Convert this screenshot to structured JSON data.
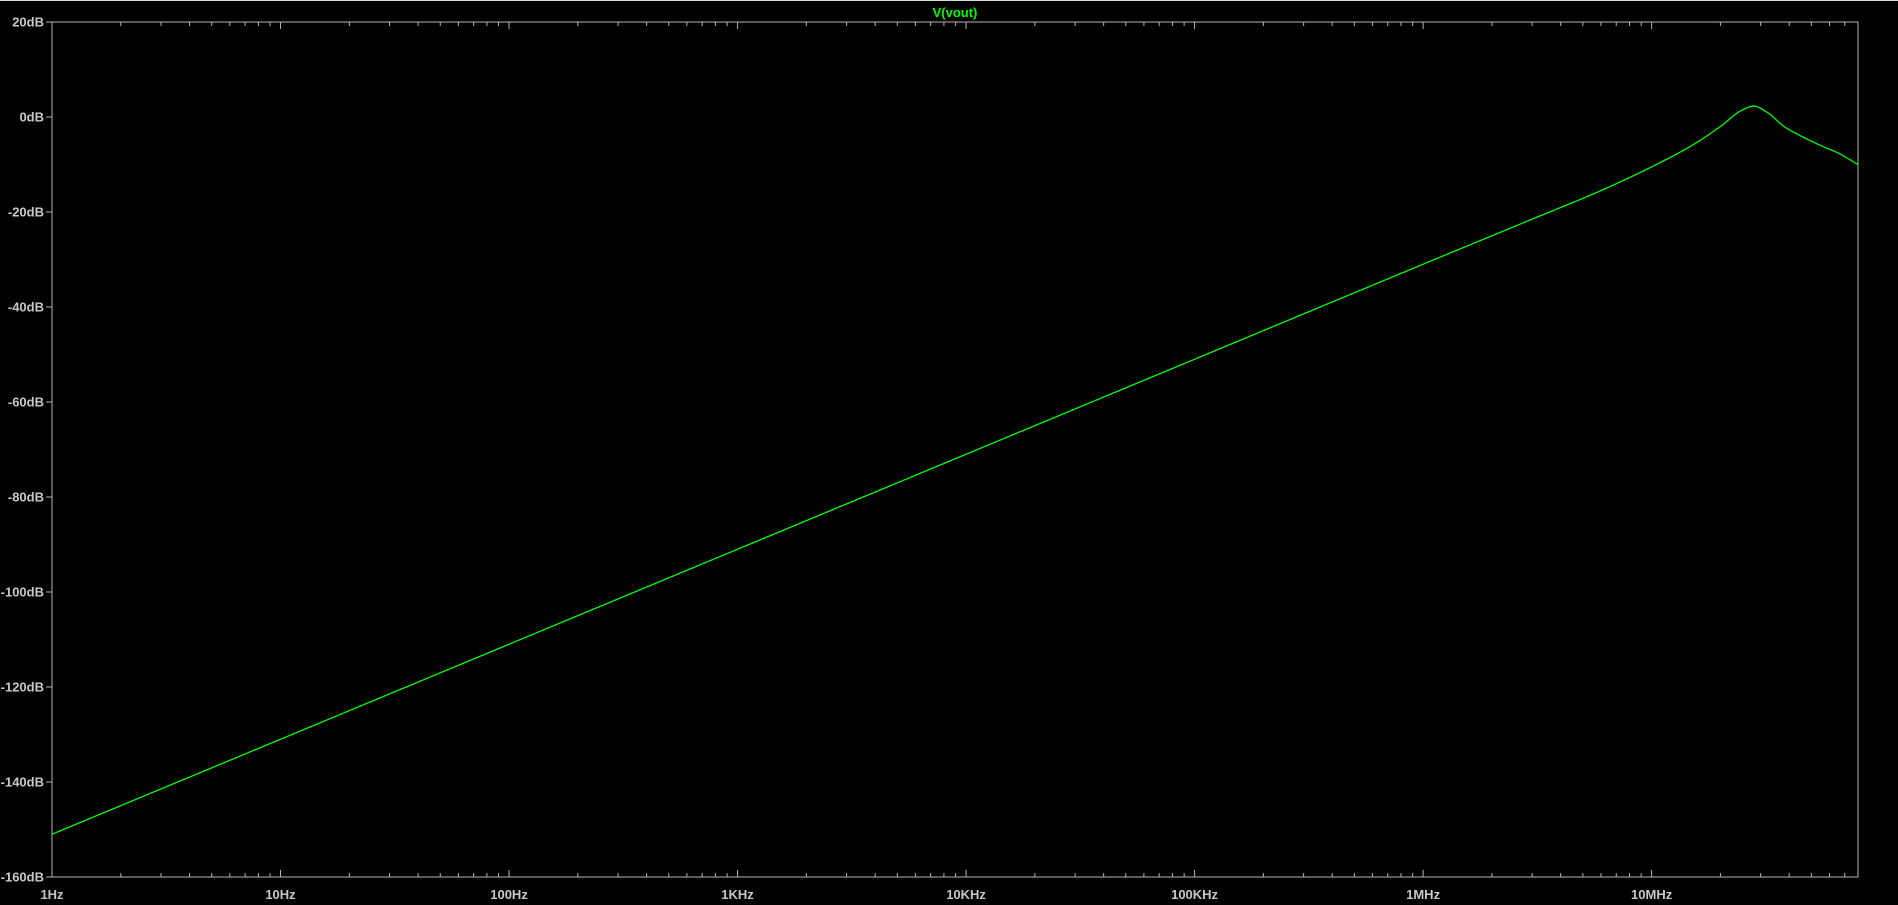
{
  "colors": {
    "background": "#000000",
    "axis": "#b4b4b4",
    "tick_text": "#c8c8c8",
    "trace": "#00ff00"
  },
  "chart_data": {
    "type": "line",
    "title": "V(vout)",
    "xlabel": "",
    "ylabel": "",
    "x_scale": "log",
    "xlim": [
      1,
      80000000
    ],
    "ylim": [
      -160,
      20
    ],
    "grid": false,
    "x_ticks": [
      {
        "value": 1,
        "label": "1Hz"
      },
      {
        "value": 10,
        "label": "10Hz"
      },
      {
        "value": 100,
        "label": "100Hz"
      },
      {
        "value": 1000,
        "label": "1KHz"
      },
      {
        "value": 10000,
        "label": "10KHz"
      },
      {
        "value": 100000,
        "label": "100KHz"
      },
      {
        "value": 1000000,
        "label": "1MHz"
      },
      {
        "value": 10000000,
        "label": "10MHz"
      }
    ],
    "y_ticks": [
      {
        "value": 20,
        "label": "20dB"
      },
      {
        "value": 0,
        "label": "0dB"
      },
      {
        "value": -20,
        "label": "-20dB"
      },
      {
        "value": -40,
        "label": "-40dB"
      },
      {
        "value": -60,
        "label": "-60dB"
      },
      {
        "value": -80,
        "label": "-80dB"
      },
      {
        "value": -100,
        "label": "-100dB"
      },
      {
        "value": -120,
        "label": "-120dB"
      },
      {
        "value": -140,
        "label": "-140dB"
      },
      {
        "value": -160,
        "label": "-160dB"
      }
    ],
    "series": [
      {
        "color": "#00ff00",
        "x": [
          1,
          10,
          100,
          1000,
          10000,
          100000,
          1000000,
          3000000,
          6000000,
          10000000,
          15000000,
          20000000,
          25000000,
          28000000,
          32000000,
          38000000,
          45000000,
          55000000,
          65000000,
          80000000
        ],
        "y": [
          -151,
          -131,
          -111,
          -91,
          -71,
          -51,
          -31,
          -21.5,
          -15.5,
          -10.5,
          -6,
          -2,
          1.5,
          2.3,
          1,
          -2,
          -4,
          -6,
          -7.5,
          -10
        ]
      }
    ]
  }
}
